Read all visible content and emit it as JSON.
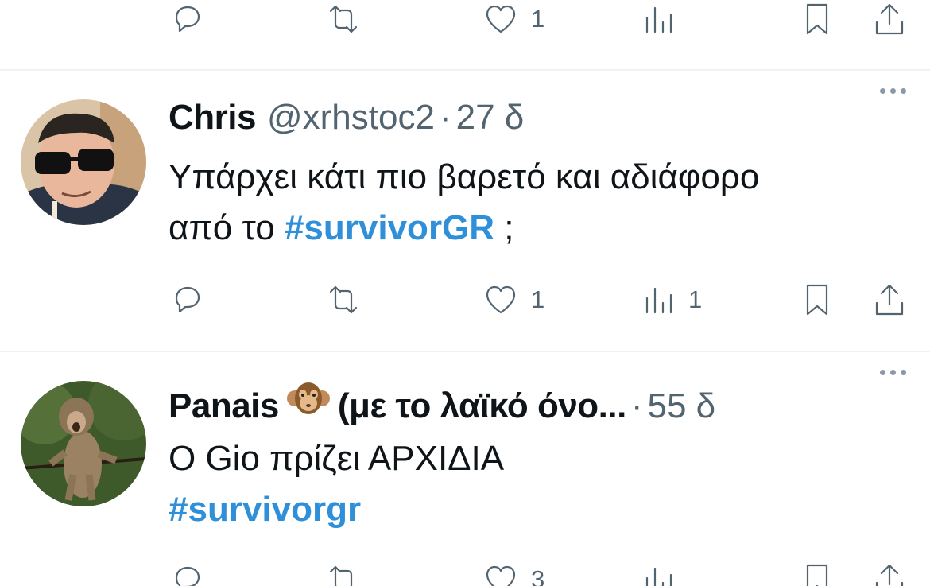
{
  "top_actions": {
    "reply_count": "",
    "retweet_count": "",
    "like_count": "1",
    "views_count": ""
  },
  "tweets": [
    {
      "name": "Chris",
      "handle": "@xrhstoc2",
      "separator": "·",
      "time": "27 δ",
      "text_line1": "Υπάρχει κάτι πιο βαρετό και αδιάφορο",
      "text_line2_prefix": "από το ",
      "hashtag": "#survivorGR",
      "text_line2_suffix": " ;",
      "reply_count": "",
      "retweet_count": "",
      "like_count": "1",
      "views_count": "1"
    },
    {
      "name": "Panais",
      "name_suffix": "(με το λαϊκό όνο...",
      "separator": "·",
      "time": "55 δ",
      "text_line1": "Ο Gio πρίζει ΑΡΧΙΔΙΑ",
      "hashtag": "#survivorgr",
      "reply_count": "",
      "retweet_count": "",
      "like_count": "3",
      "views_count": ""
    }
  ],
  "icons": {
    "reply": "reply-icon",
    "retweet": "retweet-icon",
    "like": "heart-icon",
    "views": "views-icon",
    "bookmark": "bookmark-icon",
    "share": "share-icon",
    "more": "more-icon"
  },
  "colors": {
    "hashtag": "#2f8fd8",
    "muted": "#536471",
    "divider": "#eff3f4"
  }
}
